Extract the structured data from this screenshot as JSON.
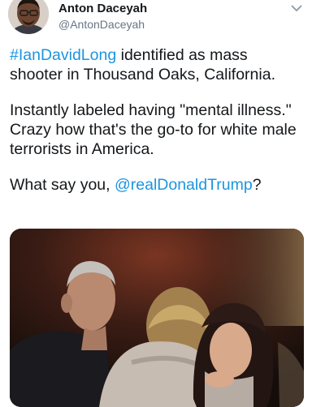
{
  "tweet": {
    "author": {
      "display_name": "Anton Daceyah",
      "handle": "@AntonDaceyah"
    },
    "menu_icon": "chevron-down-icon",
    "text": {
      "hashtag": "#IanDavidLong",
      "line1_rest": " identified as mass shooter in Thousand Oaks, California.",
      "paragraph2": "Instantly labeled having \"mental illness.\" Crazy how that's the go-to for white male terrorists in America.",
      "p3_prefix": "What say you, ",
      "mention": "@realDonaldTrump",
      "p3_suffix": "?"
    },
    "colors": {
      "link": "#1b95e0",
      "text": "#14171a",
      "secondary": "#657786"
    }
  }
}
